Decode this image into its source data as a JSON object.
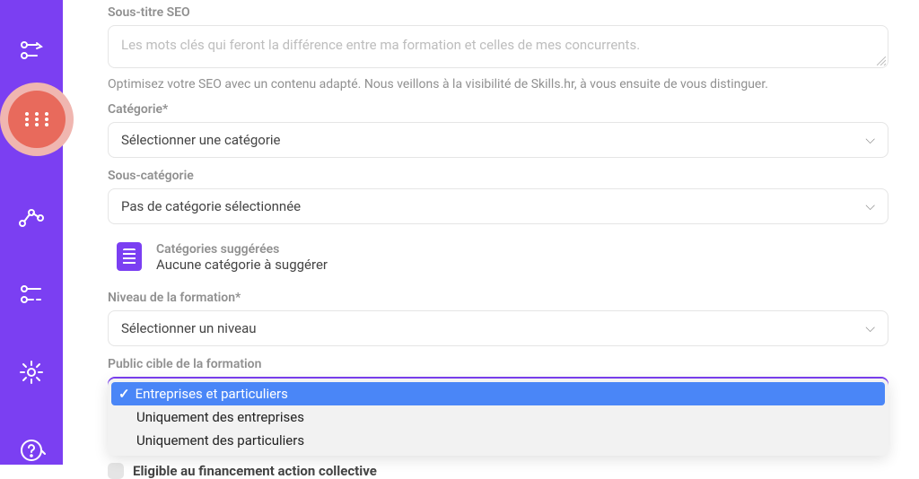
{
  "sidebar": {
    "items": [
      {
        "name": "build-icon"
      },
      {
        "name": "grid-icon"
      },
      {
        "name": "analytics-icon"
      },
      {
        "name": "equalizer-icon"
      },
      {
        "name": "settings-icon"
      },
      {
        "name": "help-icon"
      }
    ]
  },
  "seo": {
    "label": "Sous-titre SEO",
    "placeholder": "Les mots clés qui feront la différence entre ma formation et celles de mes concurrents.",
    "help": "Optimisez votre SEO avec un contenu adapté. Nous veillons à la visibilité de Skills.hr, à vous ensuite de vous distinguer."
  },
  "category": {
    "label": "Catégorie*",
    "placeholder": "Sélectionner une catégorie"
  },
  "subcategory": {
    "label": "Sous-catégorie",
    "placeholder": "Pas de catégorie sélectionnée"
  },
  "suggested": {
    "title": "Catégories suggérées",
    "text": "Aucune catégorie à suggérer"
  },
  "level": {
    "label": "Niveau de la formation*",
    "placeholder": "Sélectionner un niveau"
  },
  "audience": {
    "label": "Public cible de la formation",
    "options": [
      "Entreprises et particuliers",
      "Uniquement des entreprises",
      "Uniquement des particuliers"
    ],
    "selected_index": 0
  },
  "eligible": {
    "label": "Eligible au financement action collective"
  },
  "colors": {
    "primary": "#7B3FF2",
    "accent": "#E86A5C",
    "accent_halo": "#F0B6B0",
    "dropdown_selected": "#4A86F7"
  }
}
